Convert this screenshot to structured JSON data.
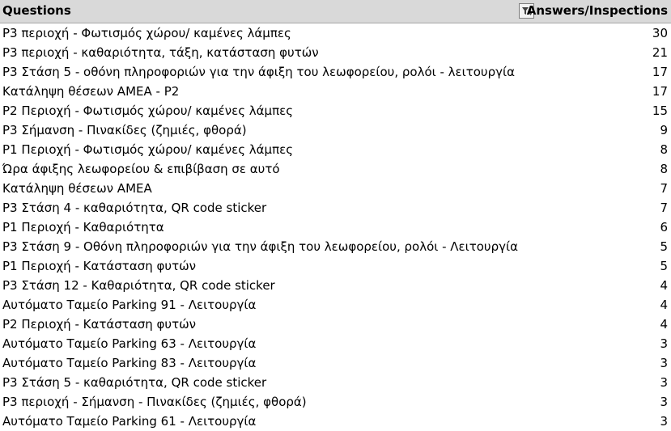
{
  "header": {
    "questions_label": "Questions",
    "answers_label": "Answers/Inspections"
  },
  "rows": [
    {
      "question": "P3 περιοχή - Φωτισμός χώρου/ καμένες λάμπες",
      "count": "30"
    },
    {
      "question": "P3 περιοχή - καθαριότητα, τάξη, κατάσταση φυτών",
      "count": "21"
    },
    {
      "question": "P3 Στάση 5 - οθόνη πληροφοριών για την άφιξη του λεωφορείου, ρολόι - λειτουργία",
      "count": "17"
    },
    {
      "question": "Κατάληψη θέσεων ΑΜΕΑ - P2",
      "count": "17"
    },
    {
      "question": "P2 Περιοχή - Φωτισμός χώρου/ καμένες λάμπες",
      "count": "15"
    },
    {
      "question": "P3 Σήμανση - Πινακίδες (ζημιές, φθορά)",
      "count": "9"
    },
    {
      "question": "P1 Περιοχή - Φωτισμός χώρου/ καμένες λάμπες",
      "count": "8"
    },
    {
      "question": "Ώρα άφιξης λεωφορείου & επιβίβαση σε αυτό",
      "count": "8"
    },
    {
      "question": "Κατάληψη θέσεων ΑΜΕΑ",
      "count": "7"
    },
    {
      "question": "P3 Στάση 4 - καθαριότητα, QR code sticker",
      "count": "7"
    },
    {
      "question": "P1 Περιοχή - Καθαριότητα",
      "count": "6"
    },
    {
      "question": "P3 Στάση 9 - Οθόνη πληροφοριών για την άφιξη του λεωφορείου, ρολόι - Λειτουργία",
      "count": "5"
    },
    {
      "question": "P1 Περιοχή - Κατάσταση φυτών",
      "count": "5"
    },
    {
      "question": "P3 Στάση 12 - Καθαριότητα, QR code sticker",
      "count": "4"
    },
    {
      "question": "Αυτόματο Ταμείο Parking 91 - Λειτουργία",
      "count": "4"
    },
    {
      "question": "P2 Περιοχή -  Κατάσταση φυτών",
      "count": "4"
    },
    {
      "question": "Αυτόματο Ταμείο Parking 63 - Λειτουργία",
      "count": "3"
    },
    {
      "question": "Αυτόματο Ταμείο Parking 83 - Λειτουργία",
      "count": "3"
    },
    {
      "question": "P3 Στάση 5 - καθαριότητα, QR code sticker",
      "count": "3"
    },
    {
      "question": "P3 περιοχή - Σήμανση - Πινακίδες (ζημιές, φθορά)",
      "count": "3"
    },
    {
      "question": "Αυτόματο Ταμείο Parking 61 - Λειτουργία",
      "count": "3"
    }
  ]
}
